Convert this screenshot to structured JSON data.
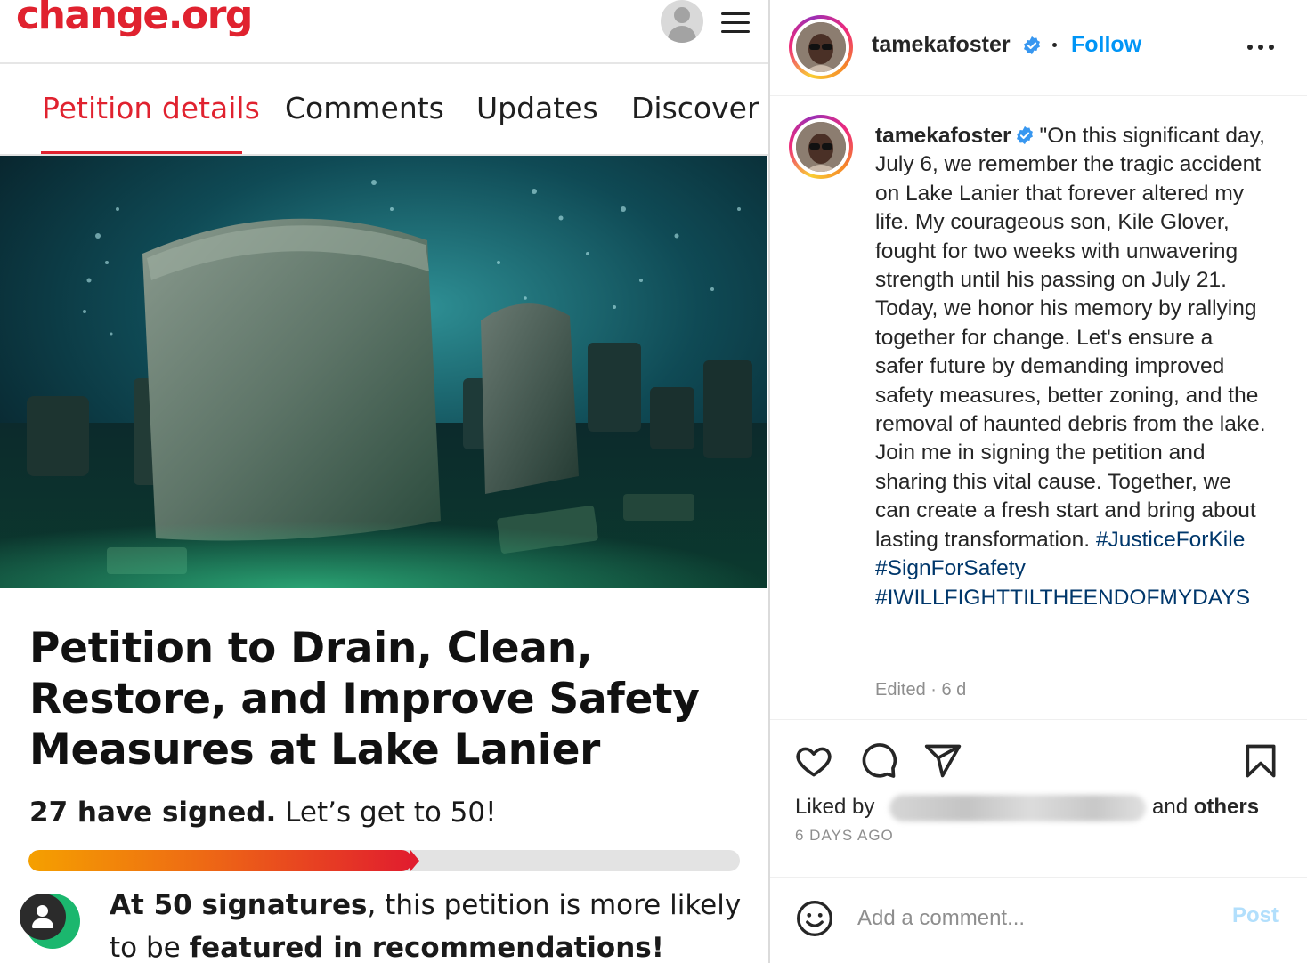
{
  "change_org": {
    "logo": "change.org",
    "header": {
      "account_icon": "user-avatar-icon",
      "menu_icon": "hamburger-menu-icon"
    },
    "tabs": [
      {
        "label": "Petition details",
        "active": true
      },
      {
        "label": "Comments",
        "active": false
      },
      {
        "label": "Updates",
        "active": false
      },
      {
        "label": "Discover",
        "active": false
      }
    ],
    "petition": {
      "title": "Petition to Drain, Clean, Restore, and Improve Safety Measures at Lake Lanier",
      "signed_count": "27 have signed.",
      "goal_text": "Let’s get to 50!",
      "progress_fraction": 0.54,
      "recommendation": {
        "bold_1": "At 50 signatures",
        "text_1": ", this petition is more likely to be ",
        "bold_2": "featured in recommendations!"
      }
    },
    "colors": {
      "brand_red": "#e0222f",
      "progress_start": "#f5a000",
      "progress_end": "#e11d2e",
      "badge_green": "#1bb76e"
    }
  },
  "instagram": {
    "username": "tamekafoster",
    "follow_label": "Follow",
    "caption": {
      "username": "tamekafoster",
      "text": "\"On this significant day, July 6, we remember the tragic accident on Lake Lanier that forever altered my life. My courageous son, Kile Glover, fought for two weeks with unwavering strength until his passing on July 21. Today, we honor his memory by rallying together for change. Let's ensure a safer future by demanding improved safety measures, better zoning, and the removal of haunted debris from the lake. Join me in signing the petition and sharing this vital cause. Together, we can create a fresh start and bring about lasting transformation.",
      "hashtags": [
        "#JusticeForKile",
        "#SignForSafety",
        "#IWILLFIGHTTILTHEENDOFMYDAYS"
      ],
      "edited": "Edited · 6 d"
    },
    "likes": {
      "prefix": "Liked by",
      "suffix_text": "and",
      "suffix_bold": "others"
    },
    "timestamp": "6 DAYS AGO",
    "comment_placeholder": "Add a comment...",
    "post_label": "Post",
    "icons": [
      "heart-icon",
      "comment-icon",
      "share-icon",
      "bookmark-icon",
      "emoji-icon",
      "verified-badge-icon",
      "more-options-icon"
    ],
    "colors": {
      "link_blue": "#0095f6",
      "hashtag": "#00376b",
      "muted": "#8e8e8e"
    }
  }
}
